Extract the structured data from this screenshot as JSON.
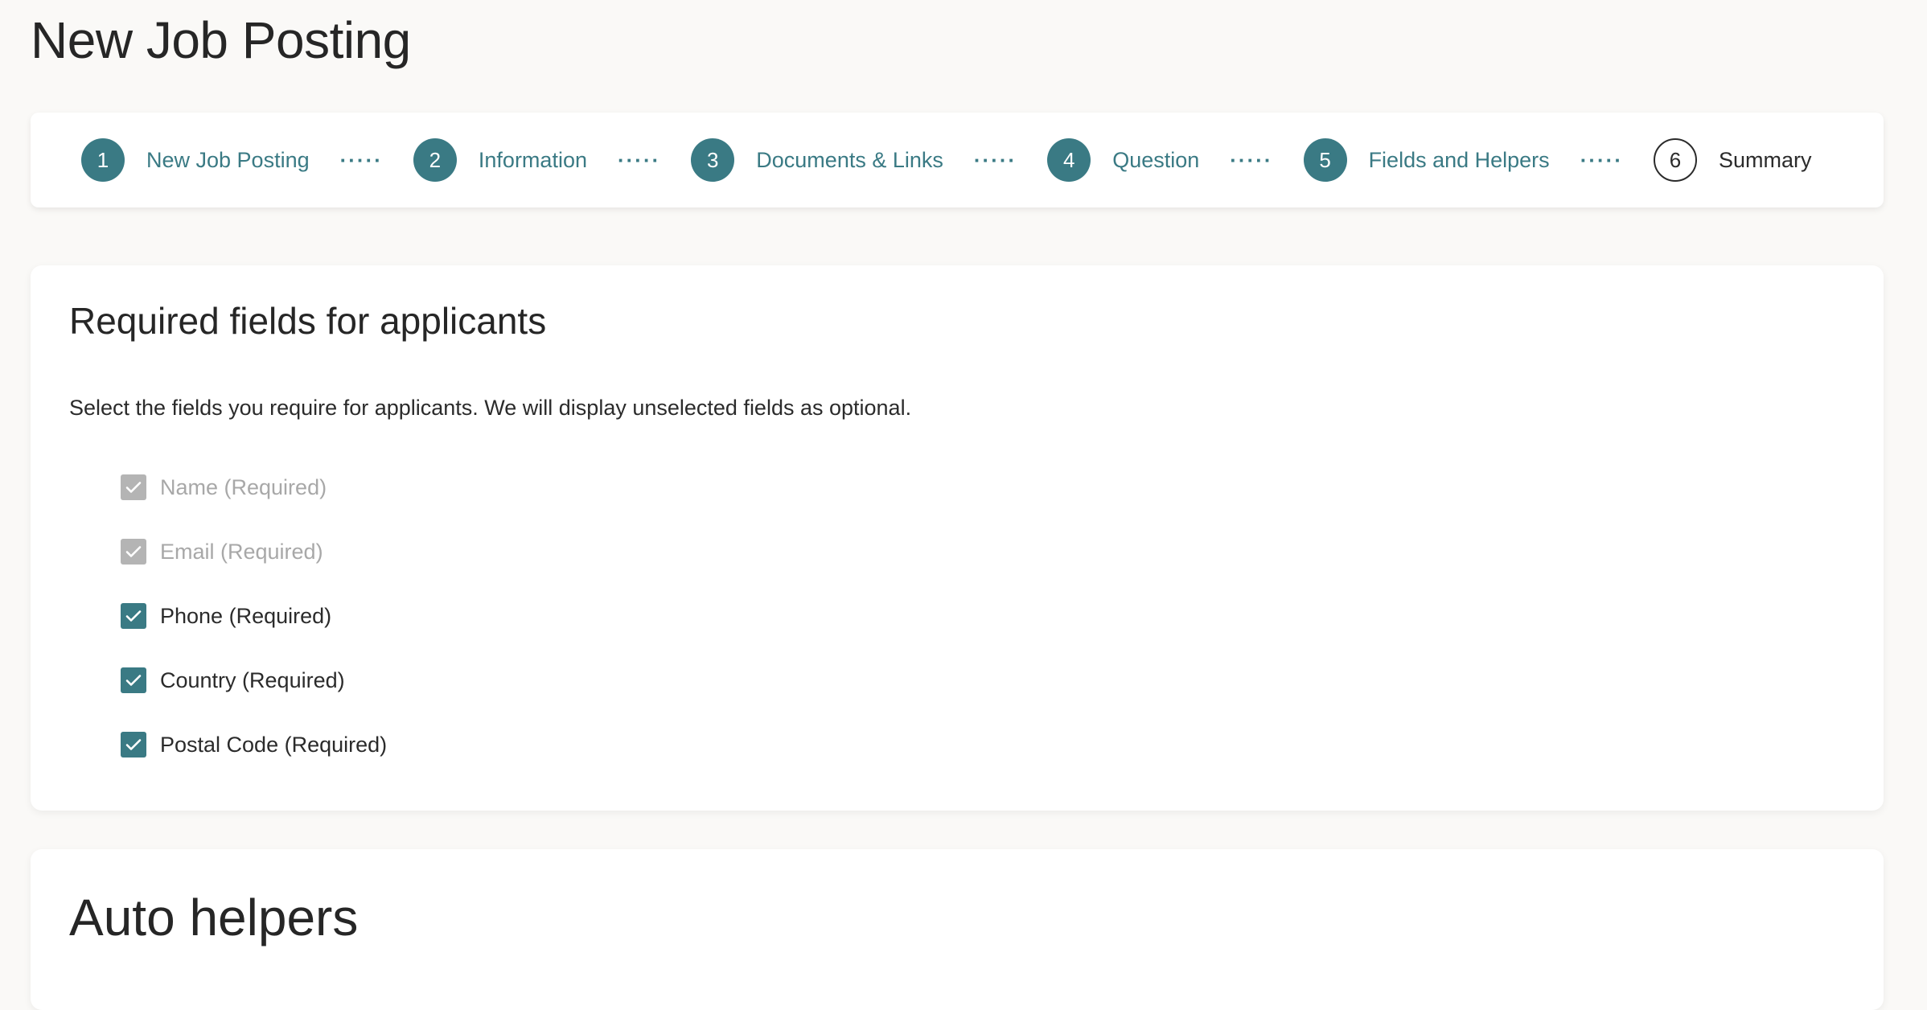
{
  "page": {
    "title": "New Job Posting"
  },
  "stepper": {
    "steps": [
      {
        "number": "1",
        "label": "New Job Posting",
        "status": "complete"
      },
      {
        "number": "2",
        "label": "Information",
        "status": "complete"
      },
      {
        "number": "3",
        "label": "Documents & Links",
        "status": "complete"
      },
      {
        "number": "4",
        "label": "Question",
        "status": "complete"
      },
      {
        "number": "5",
        "label": "Fields and Helpers",
        "status": "current"
      },
      {
        "number": "6",
        "label": "Summary",
        "status": "pending"
      }
    ],
    "separator": "·····"
  },
  "required_fields": {
    "heading": "Required fields for applicants",
    "description": "Select the fields you require for applicants. We will display unselected fields as optional.",
    "fields": [
      {
        "label": "Name (Required)",
        "checked": true,
        "disabled": true
      },
      {
        "label": "Email (Required)",
        "checked": true,
        "disabled": true
      },
      {
        "label": "Phone (Required)",
        "checked": true,
        "disabled": false
      },
      {
        "label": "Country (Required)",
        "checked": true,
        "disabled": false
      },
      {
        "label": "Postal Code (Required)",
        "checked": true,
        "disabled": false
      }
    ]
  },
  "auto_helpers": {
    "heading": "Auto helpers"
  },
  "colors": {
    "accent": "#3a7a84",
    "disabled": "#b4b4b4",
    "background": "#faf9f7"
  }
}
